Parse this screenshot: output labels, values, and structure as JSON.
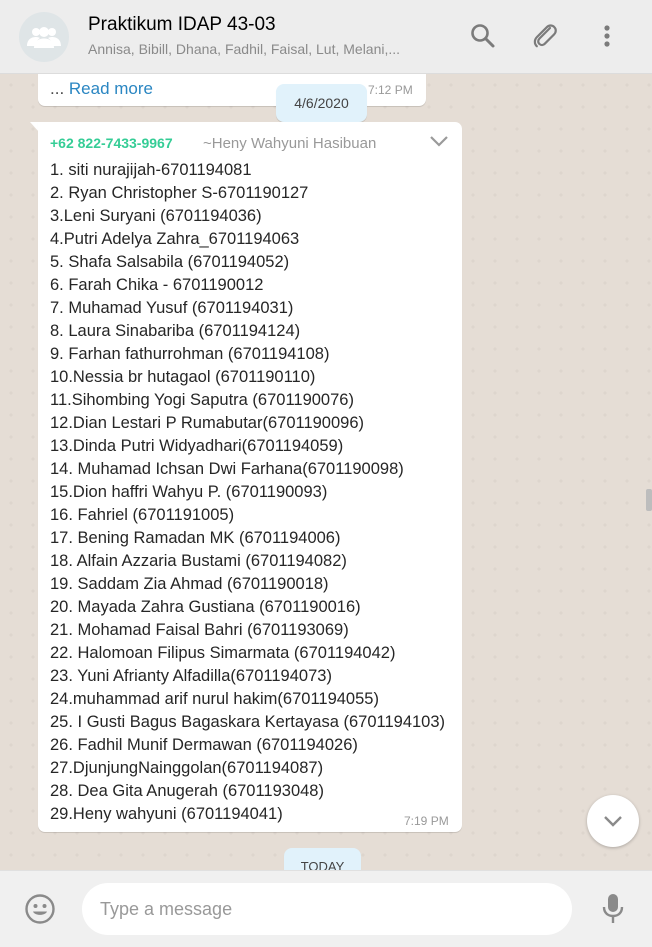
{
  "header": {
    "title": "Praktikum IDAP 43-03",
    "participants": "Annisa, Bibill, Dhana, Fadhil, Faisal, Lut, Melani,..."
  },
  "icons": {
    "avatar": "group-icon",
    "search": "search-icon",
    "attach": "paperclip-icon",
    "menu": "more-vertical-icon",
    "message_menu": "chevron-down-icon",
    "scroll": "chevron-down-icon",
    "emoji": "emoji-icon",
    "mic": "microphone-icon"
  },
  "colors": {
    "chat_background": "#e5ddd5",
    "sender_phone": "#35cd96",
    "link": "#2a86c2",
    "date_chip": "#e1f2fb"
  },
  "chat": {
    "previous_message": {
      "ellipsis": "...",
      "read_more": "Read more",
      "time": "7:12 PM"
    },
    "date_separator": "4/6/2020",
    "message": {
      "sender_phone": "+62 822-7433-9967",
      "sender_name": "~Heny Wahyuni Hasibuan",
      "lines": [
        "1. siti nurajijah-6701194081",
        "2. Ryan Christopher S-6701190127",
        "3.Leni Suryani (6701194036)",
        "4.Putri Adelya Zahra_6701194063",
        "5. Shafa Salsabila (6701194052)",
        "6. Farah Chika - 6701190012",
        "7. Muhamad Yusuf (6701194031)",
        "8. Laura Sinabariba (6701194124)",
        "9. Farhan fathurrohman (6701194108)",
        "10.Nessia br hutagaol (6701190110)",
        "11.Sihombing Yogi Saputra (6701190076)",
        "12.Dian Lestari P Rumabutar(6701190096)",
        "13.Dinda Putri Widyadhari(6701194059)",
        "14. Muhamad Ichsan Dwi Farhana(6701190098)",
        "15.Dion haffri Wahyu P. (6701190093)",
        "16. Fahriel (6701191005)",
        "17. Bening Ramadan MK (6701194006)",
        "18. Alfain Azzaria Bustami (6701194082)",
        "19. Saddam Zia Ahmad (6701190018)",
        "20. Mayada Zahra Gustiana (6701190016)",
        "21. Mohamad Faisal Bahri (6701193069)",
        "22. Halomoan Filipus Simarmata (6701194042)",
        "23. Yuni Afrianty Alfadilla(6701194073)",
        "24.muhammad arif nurul hakim(6701194055)",
        "25. I Gusti Bagus Bagaskara Kertayasa (6701194103)",
        "26. Fadhil Munif Dermawan (6701194026)",
        "27.DjunjungNainggolan(6701194087)",
        "28. Dea Gita Anugerah (6701193048)",
        "29.Heny wahyuni (6701194041)"
      ],
      "time": "7:19 PM"
    },
    "today_separator": "TODAY"
  },
  "footer": {
    "placeholder": "Type a message"
  }
}
